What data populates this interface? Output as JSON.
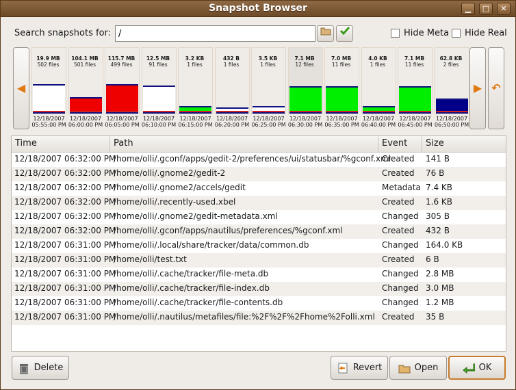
{
  "window": {
    "title": "Snapshot Browser"
  },
  "search": {
    "label": "Search snapshots for:",
    "value": "/"
  },
  "filters": {
    "hide_meta": "Hide Meta",
    "hide_real": "Hide Real"
  },
  "snapshots": [
    {
      "size": "19.9 MB",
      "files": "502 files",
      "date": "12/18/2007",
      "time": "05:55:00 PM",
      "fill": "white",
      "level": 0.62
    },
    {
      "size": "104.1 MB",
      "files": "501 files",
      "date": "12/18/2007",
      "time": "06:00:00 PM",
      "fill": "red",
      "level": 0.3
    },
    {
      "size": "115.7 MB",
      "files": "499 files",
      "date": "12/18/2007",
      "time": "06:05:00 PM",
      "fill": "red",
      "level": 0.62
    },
    {
      "size": "12.5 MB",
      "files": "91 files",
      "date": "12/18/2007",
      "time": "06:10:00 PM",
      "fill": "white",
      "level": 0.58
    },
    {
      "size": "3.2 KB",
      "files": "1 files",
      "date": "12/18/2007",
      "time": "06:15:00 PM",
      "fill": "green",
      "level": 0.1
    },
    {
      "size": "432 B",
      "files": "1 files",
      "date": "12/18/2007",
      "time": "06:20:00 PM",
      "fill": "white",
      "level": 0.06
    },
    {
      "size": "3.5 KB",
      "files": "1 files",
      "date": "12/18/2007",
      "time": "06:25:00 PM",
      "fill": "white",
      "level": 0.1
    },
    {
      "size": "7.1 MB",
      "files": "12 files",
      "date": "12/18/2007",
      "time": "06:30:00 PM",
      "fill": "green",
      "level": 0.56
    },
    {
      "size": "7.0 MB",
      "files": "11 files",
      "date": "12/18/2007",
      "time": "06:35:00 PM",
      "fill": "green",
      "level": 0.56
    },
    {
      "size": "4.0 KB",
      "files": "1 files",
      "date": "12/18/2007",
      "time": "06:40:00 PM",
      "fill": "green",
      "level": 0.1
    },
    {
      "size": "7.1 MB",
      "files": "11 files",
      "date": "12/18/2007",
      "time": "06:45:00 PM",
      "fill": "green",
      "level": 0.56
    },
    {
      "size": "62.8 KB",
      "files": "2 files",
      "date": "12/18/2007",
      "time": "06:50:00 PM",
      "fill": "navy",
      "level": 0.28
    }
  ],
  "table": {
    "headers": {
      "time": "Time",
      "path": "Path",
      "event": "Event",
      "size": "Size"
    },
    "rows": [
      {
        "time": "12/18/2007 06:32:00 PM",
        "path": "/home/olli/.gconf/apps/gedit-2/preferences/ui/statusbar/%gconf.xml",
        "event": "Created",
        "size": "141 B"
      },
      {
        "time": "12/18/2007 06:32:00 PM",
        "path": "/home/olli/.gnome2/gedit-2",
        "event": "Created",
        "size": "76 B"
      },
      {
        "time": "12/18/2007 06:32:00 PM",
        "path": "/home/olli/.gnome2/accels/gedit",
        "event": "Metadata",
        "size": "7.4 KB"
      },
      {
        "time": "12/18/2007 06:32:00 PM",
        "path": "/home/olli/.recently-used.xbel",
        "event": "Created",
        "size": "1.6 KB"
      },
      {
        "time": "12/18/2007 06:32:00 PM",
        "path": "/home/olli/.gnome2/gedit-metadata.xml",
        "event": "Changed",
        "size": "305 B"
      },
      {
        "time": "12/18/2007 06:32:00 PM",
        "path": "/home/olli/.gconf/apps/nautilus/preferences/%gconf.xml",
        "event": "Created",
        "size": "432 B"
      },
      {
        "time": "12/18/2007 06:31:00 PM",
        "path": "/home/olli/.local/share/tracker/data/common.db",
        "event": "Changed",
        "size": "164.0 KB"
      },
      {
        "time": "12/18/2007 06:31:00 PM",
        "path": "/home/olli/test.txt",
        "event": "Created",
        "size": "6 B"
      },
      {
        "time": "12/18/2007 06:31:00 PM",
        "path": "/home/olli/.cache/tracker/file-meta.db",
        "event": "Changed",
        "size": "2.8 MB"
      },
      {
        "time": "12/18/2007 06:31:00 PM",
        "path": "/home/olli/.cache/tracker/file-index.db",
        "event": "Changed",
        "size": "3.0 MB"
      },
      {
        "time": "12/18/2007 06:31:00 PM",
        "path": "/home/olli/.cache/tracker/file-contents.db",
        "event": "Changed",
        "size": "1.2 MB"
      },
      {
        "time": "12/18/2007 06:31:00 PM",
        "path": "/home/olli/.nautilus/metafiles/file:%2F%2F%2Fhome%2Folli.xml",
        "event": "Created",
        "size": "35 B"
      }
    ]
  },
  "buttons": {
    "delete": "Delete",
    "revert": "Revert",
    "open": "Open",
    "ok": "OK"
  },
  "colors": {
    "red": "#ee0000",
    "green": "#00ee00",
    "navy": "#000088",
    "white": "#ffffff",
    "accent": "#e07a10"
  }
}
